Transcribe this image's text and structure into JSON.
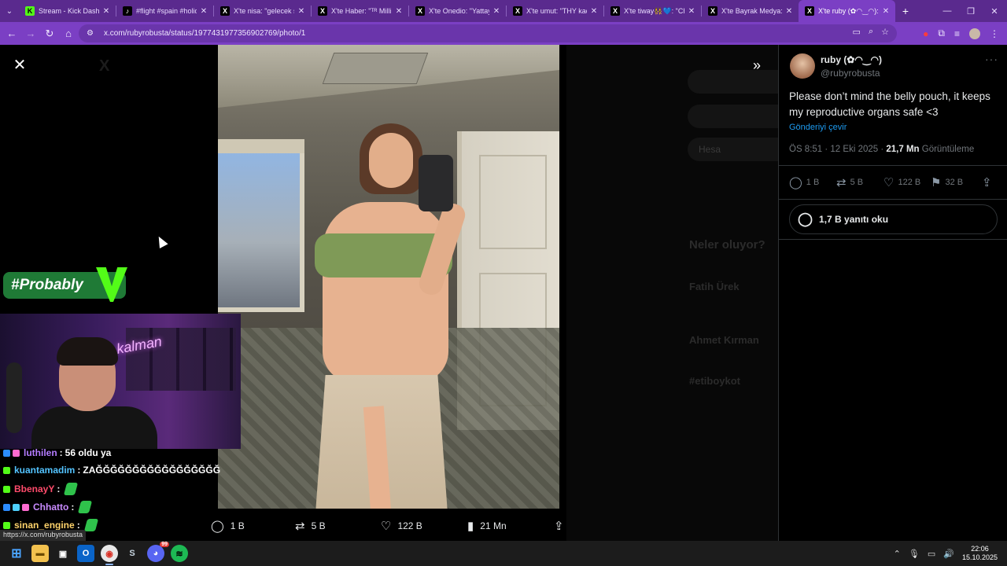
{
  "browser": {
    "tabs": [
      {
        "title": "Stream - Kick Dashbo",
        "icon": "kick-icon",
        "color": "#53fc18",
        "glyph": "K"
      },
      {
        "title": "#flight #spain #holida",
        "icon": "tiktok-icon",
        "color": "#000000",
        "glyph": "♪"
      },
      {
        "title": "X'te nisa: \"gelecek şal",
        "icon": "x-icon",
        "color": "#000000",
        "glyph": "X"
      },
      {
        "title": "X'te Haber: \"ᵀᴿ Milli p",
        "icon": "x-icon",
        "color": "#000000",
        "glyph": "X"
      },
      {
        "title": "X'te Onedio: \"Yattayk",
        "icon": "x-icon",
        "color": "#000000",
        "glyph": "X"
      },
      {
        "title": "X'te umut: \"THY kadı",
        "icon": "x-icon",
        "color": "#000000",
        "glyph": "X"
      },
      {
        "title": "X'te tiway👯‍♀️💙: \"Ch",
        "icon": "x-icon",
        "color": "#000000",
        "glyph": "X"
      },
      {
        "title": "X'te Bayrak Medya: \"I",
        "icon": "x-icon",
        "color": "#000000",
        "glyph": "X"
      },
      {
        "title": "X'te ruby (✿◠‿◠): \"",
        "icon": "x-icon",
        "color": "#000000",
        "glyph": "X",
        "active": true
      }
    ],
    "url": "x.com/rubyrobusta/status/1977431977356902769/photo/1"
  },
  "stream_overlay": {
    "badge_text": "#Probably",
    "cam_neon": "kalman",
    "chat": [
      {
        "user": "luthilen",
        "user_color": "#b47cff",
        "text": "56 oldu ya",
        "emote": false
      },
      {
        "user": "kuantamadim",
        "user_color": "#53c3ff",
        "text": "ZAĞĞĞĞĞĞĞĞĞĞĞĞĞĞĞĞĞ",
        "emote": false
      },
      {
        "user": "BbenayY",
        "user_color": "#ff4b6b",
        "text": "",
        "emote": true
      },
      {
        "user": "Chhatto",
        "user_color": "#c98bff",
        "text": "",
        "emote": true
      },
      {
        "user": "sinan_engine",
        "user_color": "#ffd36b",
        "text": "",
        "emote": true
      }
    ],
    "status_url": "https://x.com/rubyrobusta"
  },
  "photo_actions": {
    "replies": "1 B",
    "reposts": "5 B",
    "likes": "122 B",
    "views": "21 Mn"
  },
  "background_feed": {
    "trending_title": "Neler oluyor?",
    "items": [
      "Fatih Ürek",
      "Ahmet Kırman",
      "#etiboykot"
    ],
    "pill_label": "Hesa"
  },
  "tweet": {
    "display_name": "ruby (✿◠‿◠)",
    "handle": "@rubyrobusta",
    "text": "Please don’t mind the belly pouch, it keeps my reproductive organs safe <3",
    "translate": "Gönderiyi çevir",
    "time": "ÖS 8:51 · 12 Eki 2025 · ",
    "views_count": "21,7 Mn",
    "views_label": " Görüntüleme",
    "replies": "1 B",
    "reposts": "5 B",
    "likes": "122 B",
    "bookmarks": "32 B",
    "read_replies": "1,7 B yanıtı oku"
  },
  "taskbar": {
    "time": "22:06",
    "date": "15.10.2025",
    "discord_badge": "99"
  }
}
